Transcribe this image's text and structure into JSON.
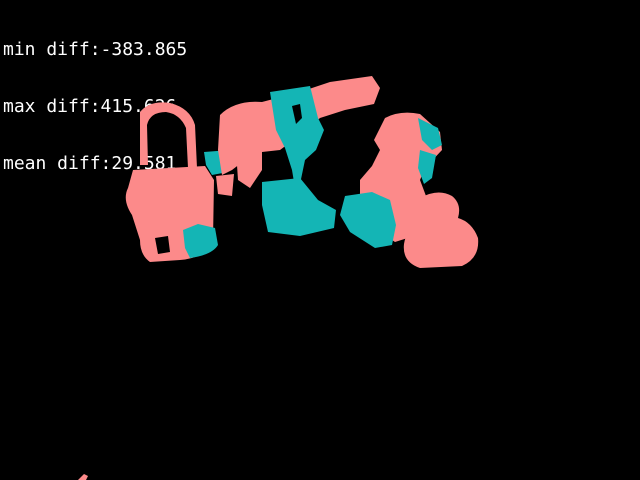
{
  "stats": {
    "min_line": "min diff:-383.865",
    "max_line": "max diff:415.626",
    "mean_line": "mean diff:29.581"
  },
  "colors": {
    "background": "#000000",
    "positive": "#fc8a8a",
    "negative": "#14b5b5",
    "text": "#ffffff"
  }
}
